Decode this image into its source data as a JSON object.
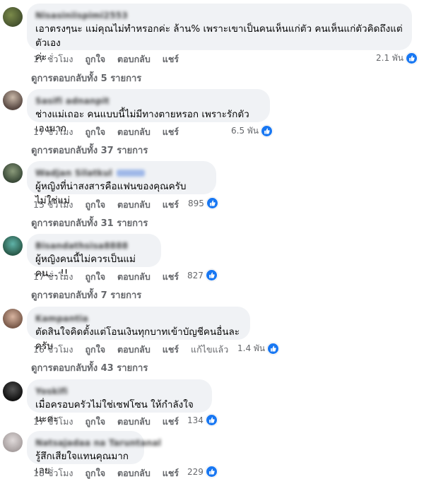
{
  "comments": [
    {
      "name": "Nisasiniispimi2553",
      "text_lines": [
        "เอาตรงๆนะ แม่คุณไม่ทำหรอกค่ะ ล้าน% เพราะเขาเป็นคนเห็นแก่ตัว คนเห็นแก่ตัวคิดถึงแต่ตัวเอง",
        "ค่ะ"
      ],
      "time": "17 ชั่วโมง",
      "like": "ถูกใจ",
      "reply": "ตอบกลับ",
      "share": "แชร์",
      "edited": "",
      "reactions": "2.1 พัน",
      "view_replies": "ดูการตอบกลับทั้ง 5 รายการ"
    },
    {
      "name": "Sasifi adnanpit",
      "text_lines": [
        "ช่างแม่เถอะ คนแบบนี้ไม่มีทางตายหรอก เพราะรักตัวเองมาก"
      ],
      "time": "17 ชั่วโมง",
      "like": "ถูกใจ",
      "reply": "ตอบกลับ",
      "share": "แชร์",
      "edited": "",
      "reactions": "6.5 พัน",
      "view_replies": "ดูการตอบกลับทั้ง 37 รายการ"
    },
    {
      "name": "Wadjan Silatkul",
      "text_lines": [
        "ผู้หญิงที่น่าสงสารคือแฟนของคุณครับไม่ใช่แม่"
      ],
      "time": "15 ชั่วโมง",
      "like": "ถูกใจ",
      "reply": "ตอบกลับ",
      "share": "แชร์",
      "edited": "",
      "reactions": "895",
      "view_replies": "ดูการตอบกลับทั้ง 31 รายการ"
    },
    {
      "name": "Bisandathsisa8888",
      "text_lines": [
        "ผู้หญิงคนนี้ไม่ควรเป็นแม่คน... !!"
      ],
      "time": "17 ชั่วโมง",
      "like": "ถูกใจ",
      "reply": "ตอบกลับ",
      "share": "แชร์",
      "edited": "",
      "reactions": "827",
      "view_replies": "ดูการตอบกลับทั้ง 7 รายการ"
    },
    {
      "name": "Kampantia",
      "text_lines": [
        "ตัดสินใจคิดตั้งแต่โอนเงินทุกบาทเข้าบัญชีคนอื่นละครับ"
      ],
      "time": "16 ชั่วโมง",
      "like": "ถูกใจ",
      "reply": "ตอบกลับ",
      "share": "แชร์",
      "edited": "แก้ไขแล้ว",
      "reactions": "1.4 พัน",
      "view_replies": "ดูการตอบกลับทั้ง 43 รายการ"
    },
    {
      "name": "Yoskifi",
      "text_lines": [
        "เมื่อครอบครัวไม่ใช่เซฟโซน ให้กำลังใจนะคะ"
      ],
      "time": "17 ชั่วโมง",
      "like": "ถูกใจ",
      "reply": "ตอบกลับ",
      "share": "แชร์",
      "edited": "",
      "reactions": "134",
      "view_replies": ""
    },
    {
      "name": "Natsajadaa na Taruntanal",
      "text_lines": [
        "รู้สึกเสียใจแทนคุณมากเลย"
      ],
      "time": "18 ชั่วโมง",
      "like": "ถูกใจ",
      "reply": "ตอบกลับ",
      "share": "แชร์",
      "edited": "",
      "reactions": "229",
      "view_replies": ""
    }
  ],
  "colors": {
    "bubble": "#f0f2f5",
    "secondary_text": "#65676b",
    "like_blue": "#1877f2"
  },
  "icons": {
    "reaction": "thumbs-up-icon"
  }
}
